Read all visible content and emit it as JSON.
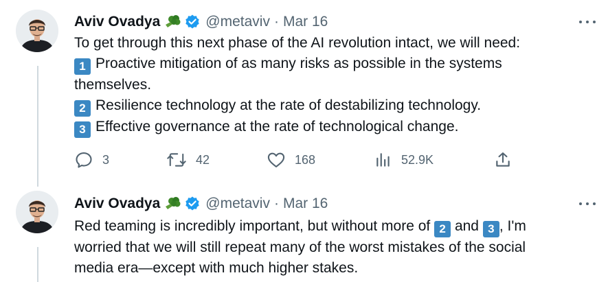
{
  "tweets": [
    {
      "author": {
        "name": "Aviv Ovadya",
        "handle": "@metaviv",
        "emoji_icon": "broccoli-icon",
        "verified_icon": "verified-badge-icon"
      },
      "separator": "·",
      "date": "Mar 16",
      "more_icon": "more-options-icon",
      "lines": {
        "intro": "To get through this next phase of the AI revolution intact, we will need:",
        "item1_badge": "1",
        "item1_text_a": "Proactive mitigation of as many risks as possible in the systems",
        "item1_text_b": "themselves.",
        "item2_badge": "2",
        "item2_text": "Resilience technology at the rate of destabilizing technology.",
        "item3_badge": "3",
        "item3_text": "Effective governance at the rate of technological change."
      },
      "actions": {
        "reply": {
          "icon": "reply-icon",
          "count": "3"
        },
        "retweet": {
          "icon": "retweet-icon",
          "count": "42"
        },
        "like": {
          "icon": "heart-icon",
          "count": "168"
        },
        "views": {
          "icon": "views-chart-icon",
          "count": "52.9K"
        },
        "share": {
          "icon": "share-icon"
        }
      }
    },
    {
      "author": {
        "name": "Aviv Ovadya",
        "handle": "@metaviv",
        "emoji_icon": "broccoli-icon",
        "verified_icon": "verified-badge-icon"
      },
      "separator": "·",
      "date": "Mar 16",
      "more_icon": "more-options-icon",
      "lines": {
        "l1_a": "Red teaming is incredibly important, but without more of",
        "l1_badge2": "2",
        "l1_and": "and",
        "l1_badge3": "3",
        "l1_b": ", I'm",
        "l2": "worried that we will still repeat many of the worst mistakes of the social",
        "l3": "media era—except with much higher stakes."
      }
    }
  ],
  "colors": {
    "text": "#0f1419",
    "secondary": "#536471",
    "verified": "#1d9bf0",
    "keycap": "#3b88c3",
    "thread_line": "#cfd9de"
  }
}
